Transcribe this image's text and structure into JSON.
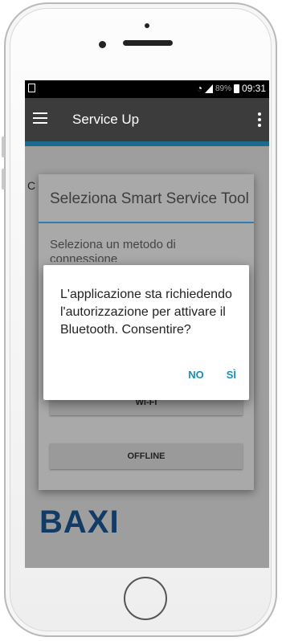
{
  "statusbar": {
    "battery": "89%",
    "time": "09:31"
  },
  "appbar": {
    "title": "Service Up"
  },
  "background": {
    "left_letter": "C",
    "brand": "BAXI"
  },
  "dialog": {
    "title": "Seleziona Smart Service Tool",
    "subtitle": "Seleziona un metodo di connessione",
    "options": [
      "WI-FI",
      "OFFLINE"
    ]
  },
  "permission_dialog": {
    "message": "L'applicazione sta richiedendo l'autorizzazione per attivare il Bluetooth. Consentire?",
    "deny_label": "NO",
    "allow_label": "SÌ"
  },
  "colors": {
    "accent": "#1b6b8f",
    "action": "#1b8db5",
    "brand": "#123b66"
  }
}
